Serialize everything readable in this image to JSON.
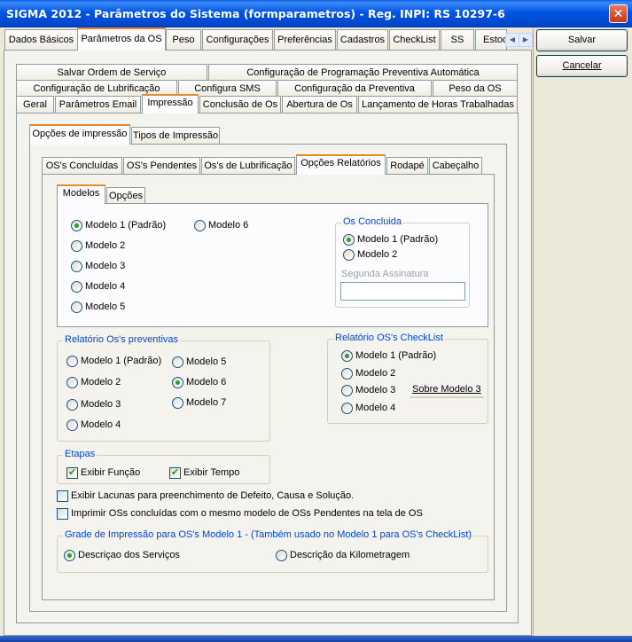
{
  "window": {
    "title": "SIGMA 2012 - Parâmetros do Sistema  (formparametros)  - Reg. INPI: RS 10297-6",
    "close_symbol": "✕"
  },
  "main_tabs": [
    "Dados Básicos",
    "Parâmetros da OS",
    "Peso",
    "Configurações",
    "Preferências",
    "Cadastros",
    "CheckList",
    "SS",
    "Estoq"
  ],
  "tab_scroll": {
    "left": "◀",
    "right": "▶"
  },
  "actions": {
    "save": "Salvar",
    "cancel": "Cancelar"
  },
  "os_tabs": {
    "row1": [
      "Salvar Ordem de Serviço",
      "Configuração de Programação Preventiva Automática"
    ],
    "row2": [
      "Configuração de Lubrificação",
      "Configura SMS",
      "Configuração da Preventiva",
      "Peso da OS"
    ],
    "row3": [
      "Geral",
      "Parâmetros Email",
      "Impressão",
      "Conclusão de Os",
      "Abertura de Os",
      "Lançamento de Horas Trabalhadas"
    ]
  },
  "print_tabs": [
    "Opções de impressão",
    "Tipos de Impressão"
  ],
  "report_tabs": [
    "OS's Concluídas",
    "OS's Pendentes",
    "Os's de Lubrificação",
    "Opções Relatórios",
    "Rodapé",
    "Cabeçalho"
  ],
  "model_tabs": [
    "Modelos",
    "Opções"
  ],
  "modelos": {
    "options": [
      "Modelo 1 (Padrão)",
      "Modelo 2",
      "Modelo 3",
      "Modelo 4",
      "Modelo 5",
      "Modelo 6"
    ],
    "selected": "Modelo 1 (Padrão)"
  },
  "os_concluida": {
    "title": "Os Concluida",
    "options": [
      "Modelo 1 (Padrão)",
      "Modelo 2"
    ],
    "selected": "Modelo 1 (Padrão)",
    "second_signature_label": "Segunda Assinatura",
    "second_signature_value": ""
  },
  "preventivas": {
    "title": "Relatório Os's preventivas",
    "options": [
      "Modelo 1 (Padrão)",
      "Modelo 2",
      "Modelo 3",
      "Modelo 4",
      "Modelo 5",
      "Modelo 6",
      "Modelo 7"
    ],
    "selected": "Modelo 6"
  },
  "checklist": {
    "title": "Relatório OS's CheckList",
    "options": [
      "Modelo 1 (Padrão)",
      "Modelo 2",
      "Modelo 3",
      "Modelo 4"
    ],
    "selected": "Modelo 1 (Padrão)",
    "about_button": "Sobre Modelo 3"
  },
  "etapas": {
    "title": "Etapas",
    "exibir_funcao": "Exibir Função",
    "exibir_tempo": "Exibir Tempo",
    "funcao_checked": true,
    "tempo_checked": true
  },
  "options": {
    "lacunas": "Exibir Lacunas para preenchimento de Defeito, Causa e Solução.",
    "imprimir": "Imprimir OSs concluídas com o mesmo modelo de OSs Pendentes na tela de OS",
    "lacunas_checked": false,
    "imprimir_checked": false
  },
  "grade": {
    "title": "Grade de Impressão para OS's Modelo 1 - (Também usado no Modelo 1 para OS's CheckList)",
    "servicos": "Descriçao dos Serviços",
    "kilometragem": "Descrição da Kilometragem",
    "selected": "Descriçao dos Serviços"
  }
}
